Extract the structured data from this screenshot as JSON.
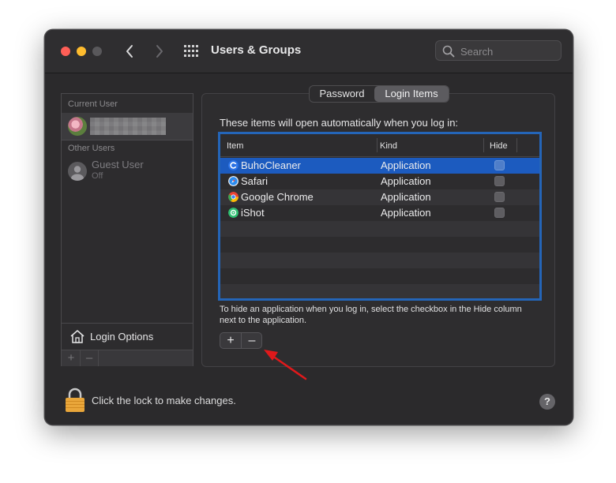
{
  "window": {
    "title": "Users & Groups",
    "search_placeholder": "Search"
  },
  "users": {
    "current_user_label": "Current User",
    "other_users_label": "Other Users",
    "guest_name": "Guest User",
    "guest_status": "Off",
    "login_options": "Login Options",
    "add_label": "+",
    "remove_label": "–"
  },
  "tabs": {
    "password": "Password",
    "login_items": "Login Items",
    "selected": "Login Items"
  },
  "login_items": {
    "intro": "These items will open automatically when you log in:",
    "columns": [
      "Item",
      "Kind",
      "Hide"
    ],
    "rows": [
      {
        "name": "BuhoCleaner",
        "kind": "Application",
        "hide": false,
        "selected": true
      },
      {
        "name": "Safari",
        "kind": "Application",
        "hide": false,
        "selected": false
      },
      {
        "name": "Google Chrome",
        "kind": "Application",
        "hide": false,
        "selected": false
      },
      {
        "name": "iShot",
        "kind": "Application",
        "hide": false,
        "selected": false
      }
    ],
    "note": "To hide an application when you log in, select the checkbox in the Hide column next to the application.",
    "add_label": "+",
    "remove_label": "–"
  },
  "footer": {
    "lock_text": "Click the lock to make changes.",
    "help_label": "?"
  },
  "colors": {
    "accent": "#2465b8",
    "selection": "#1c5bbf",
    "arrow": "#e0191b"
  }
}
